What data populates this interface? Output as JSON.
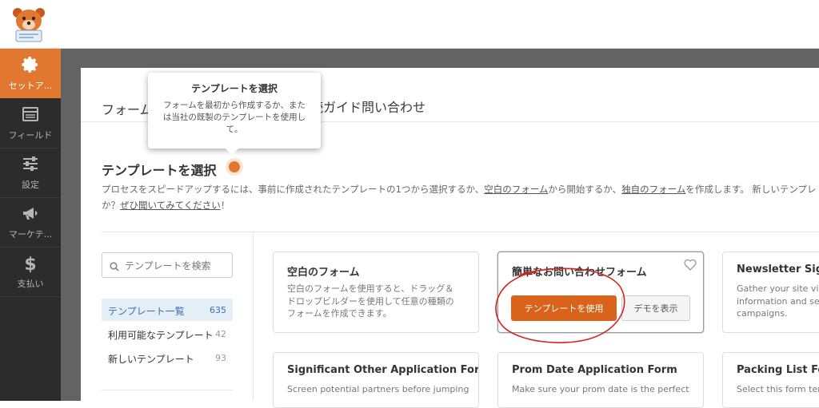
{
  "sidebar": {
    "items": [
      {
        "label": "セットア...",
        "icon": "gear-icon",
        "active": true
      },
      {
        "label": "フィールド",
        "icon": "fields-icon"
      },
      {
        "label": "設定",
        "icon": "sliders-icon"
      },
      {
        "label": "マーケテ...",
        "icon": "megaphone-icon"
      },
      {
        "label": "支払い",
        "icon": "dollar-icon"
      }
    ]
  },
  "header": {
    "form_label": "フォーム",
    "form_name": "続ガイド問い合わせ"
  },
  "tooltip": {
    "title": "テンプレートを選択",
    "body": "フォームを最初から作成するか、または当社の既製のテンプレートを使用して。"
  },
  "section": {
    "title": "テンプレートを選択",
    "desc_1": "プロセスをスピードアップするには、事前に作成されたテンプレートの1つから選択するか、",
    "desc_link1": "空白のフォーム",
    "desc_2": "から開始するか、",
    "desc_link2": "独自のフォーム",
    "desc_3": "を作成します。 新しいテンプレ",
    "desc_4": "か？",
    "desc_link3": "ぜひ聞いてみてください",
    "desc_5": "！"
  },
  "search": {
    "placeholder": "テンプレートを検索"
  },
  "categories": [
    {
      "label": "テンプレート一覧",
      "count": "635",
      "active": true
    },
    {
      "label": "利用可能なテンプレート",
      "count": "42"
    },
    {
      "label": "新しいテンプレート",
      "count": "93"
    }
  ],
  "cards": [
    {
      "title": "空白のフォーム",
      "desc_1": "空白のフォームを使用すると、ドラッグ＆",
      "desc_2": "ドロップビルダーを使用して任意の種類の",
      "desc_3": "フォームを作成できます。"
    },
    {
      "title": "簡単なお問い合わせフォーム",
      "use_label": "テンプレートを使用",
      "demo_label": "デモを表示"
    },
    {
      "title": "Newsletter Signu",
      "desc_1": "Gather your site visit",
      "desc_2": "information and sen",
      "desc_3": "campaigns."
    },
    {
      "title": "Significant Other Application Form",
      "desc_1": "Screen potential partners before jumping"
    },
    {
      "title": "Prom Date Application Form",
      "desc_1": "Make sure your prom date is the perfect"
    },
    {
      "title": "Packing List Form",
      "desc_1": "Select this form term"
    }
  ],
  "colors": {
    "accent": "#e27730",
    "button": "#d9631b",
    "sidebar_bg": "#2c2c2c",
    "overlay": "#636363",
    "annotation": "#d6231c"
  }
}
